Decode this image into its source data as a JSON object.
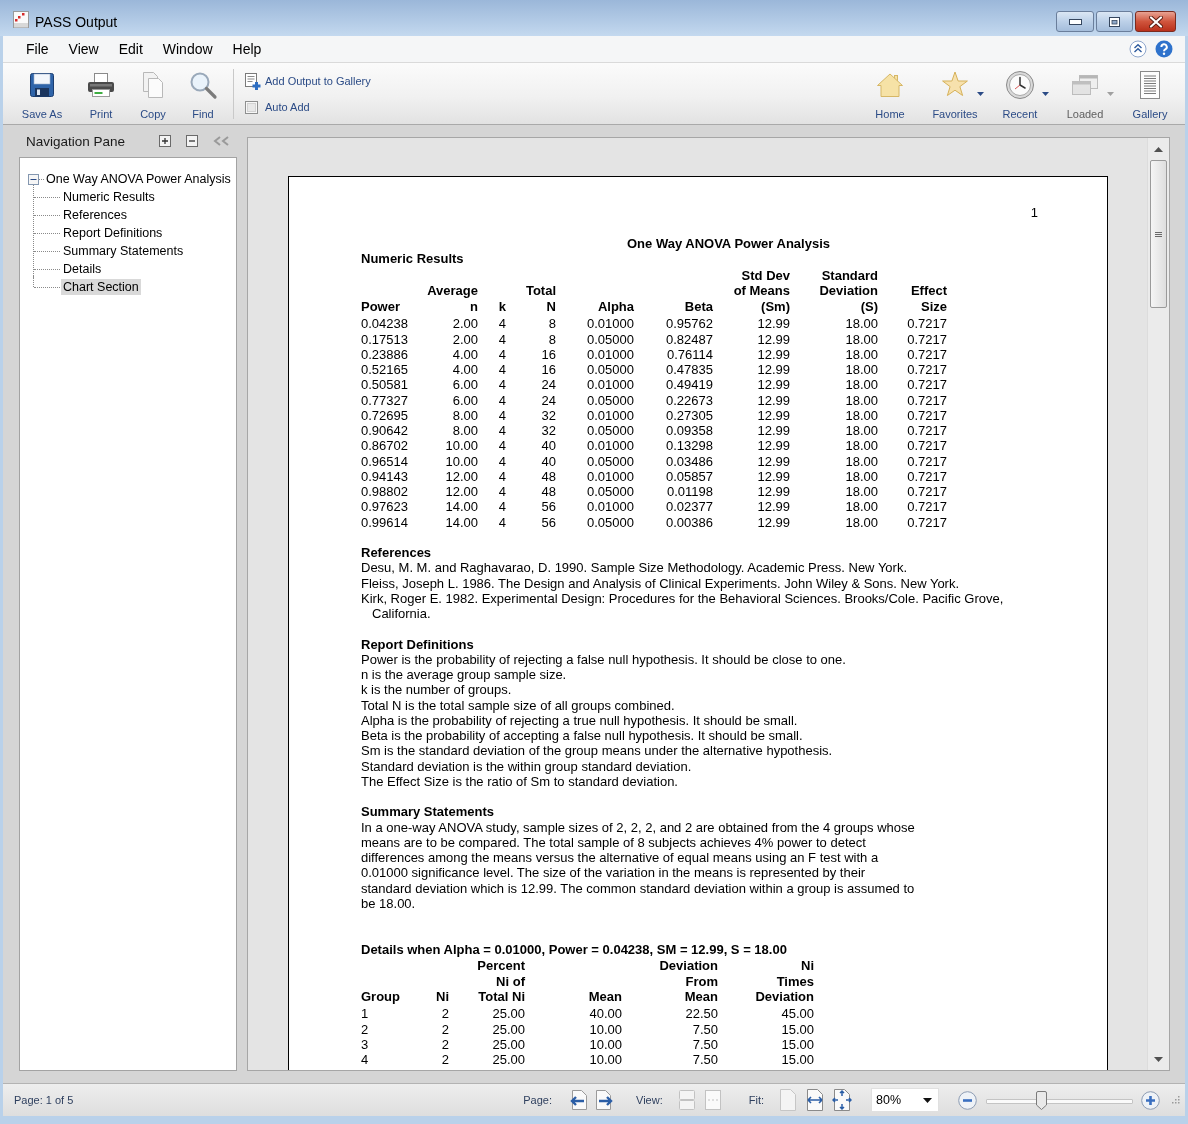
{
  "window": {
    "title": "PASS Output"
  },
  "menu": [
    {
      "label": "File"
    },
    {
      "label": "View"
    },
    {
      "label": "Edit"
    },
    {
      "label": "Window"
    },
    {
      "label": "Help"
    }
  ],
  "toolbar": {
    "buttons": [
      {
        "label": "Save As"
      },
      {
        "label": "Print"
      },
      {
        "label": "Copy"
      },
      {
        "label": "Find"
      }
    ],
    "add_to_gallery": {
      "label": "Add Output to Gallery"
    },
    "auto_add": {
      "label": "Auto Add",
      "checked": false
    },
    "nav_buttons": [
      {
        "label": "Home",
        "dropdown": false,
        "disabled": false
      },
      {
        "label": "Favorites",
        "dropdown": true,
        "disabled": false
      },
      {
        "label": "Recent",
        "dropdown": true,
        "disabled": false
      },
      {
        "label": "Loaded",
        "dropdown": true,
        "disabled": true
      },
      {
        "label": "Gallery",
        "dropdown": false,
        "disabled": false
      }
    ]
  },
  "navigation_pane": {
    "title": "Navigation Pane",
    "tree": [
      {
        "label": "One Way ANOVA Power Analysis",
        "expanded": true,
        "selected": false,
        "children": [
          {
            "label": "Numeric Results",
            "selected": false
          },
          {
            "label": "References",
            "selected": false
          },
          {
            "label": "Report Definitions",
            "selected": false
          },
          {
            "label": "Summary Statements",
            "selected": false
          },
          {
            "label": "Details",
            "selected": false
          },
          {
            "label": "Chart Section",
            "selected": true
          }
        ]
      }
    ]
  },
  "document": {
    "page_number": "1",
    "title": "One Way ANOVA Power Analysis",
    "numeric_results": {
      "heading": "Numeric Results",
      "columns": [
        {
          "lines": [
            "Power"
          ]
        },
        {
          "lines": [
            "Average",
            "n"
          ]
        },
        {
          "lines": [
            "k"
          ]
        },
        {
          "lines": [
            "Total",
            "N"
          ]
        },
        {
          "lines": [
            "Alpha"
          ]
        },
        {
          "lines": [
            "Beta"
          ]
        },
        {
          "lines": [
            "Std Dev",
            "of Means",
            "(Sm)"
          ]
        },
        {
          "lines": [
            "Standard",
            "Deviation",
            "(S)"
          ]
        },
        {
          "lines": [
            "Effect",
            "Size"
          ]
        }
      ],
      "rows": [
        [
          "0.04238",
          "2.00",
          "4",
          "8",
          "0.01000",
          "0.95762",
          "12.99",
          "18.00",
          "0.7217"
        ],
        [
          "0.17513",
          "2.00",
          "4",
          "8",
          "0.05000",
          "0.82487",
          "12.99",
          "18.00",
          "0.7217"
        ],
        [
          "0.23886",
          "4.00",
          "4",
          "16",
          "0.01000",
          "0.76114",
          "12.99",
          "18.00",
          "0.7217"
        ],
        [
          "0.52165",
          "4.00",
          "4",
          "16",
          "0.05000",
          "0.47835",
          "12.99",
          "18.00",
          "0.7217"
        ],
        [
          "0.50581",
          "6.00",
          "4",
          "24",
          "0.01000",
          "0.49419",
          "12.99",
          "18.00",
          "0.7217"
        ],
        [
          "0.77327",
          "6.00",
          "4",
          "24",
          "0.05000",
          "0.22673",
          "12.99",
          "18.00",
          "0.7217"
        ],
        [
          "0.72695",
          "8.00",
          "4",
          "32",
          "0.01000",
          "0.27305",
          "12.99",
          "18.00",
          "0.7217"
        ],
        [
          "0.90642",
          "8.00",
          "4",
          "32",
          "0.05000",
          "0.09358",
          "12.99",
          "18.00",
          "0.7217"
        ],
        [
          "0.86702",
          "10.00",
          "4",
          "40",
          "0.01000",
          "0.13298",
          "12.99",
          "18.00",
          "0.7217"
        ],
        [
          "0.96514",
          "10.00",
          "4",
          "40",
          "0.05000",
          "0.03486",
          "12.99",
          "18.00",
          "0.7217"
        ],
        [
          "0.94143",
          "12.00",
          "4",
          "48",
          "0.01000",
          "0.05857",
          "12.99",
          "18.00",
          "0.7217"
        ],
        [
          "0.98802",
          "12.00",
          "4",
          "48",
          "0.05000",
          "0.01198",
          "12.99",
          "18.00",
          "0.7217"
        ],
        [
          "0.97623",
          "14.00",
          "4",
          "56",
          "0.01000",
          "0.02377",
          "12.99",
          "18.00",
          "0.7217"
        ],
        [
          "0.99614",
          "14.00",
          "4",
          "56",
          "0.05000",
          "0.00386",
          "12.99",
          "18.00",
          "0.7217"
        ]
      ]
    },
    "references": {
      "heading": "References",
      "items": [
        "Desu, M. M. and Raghavarao, D. 1990. Sample Size Methodology. Academic Press. New York.",
        "Fleiss, Joseph L. 1986. The Design and Analysis of Clinical Experiments. John Wiley & Sons. New York.",
        "Kirk, Roger E. 1982. Experimental Design: Procedures for the Behavioral Sciences. Brooks/Cole. Pacific Grove, California."
      ]
    },
    "report_definitions": {
      "heading": "Report Definitions",
      "lines": [
        "Power is the probability of rejecting a false null hypothesis. It should be close to one.",
        "n is the average group sample size.",
        "k is the number of groups.",
        "Total N is the total sample size of all groups combined.",
        "Alpha is the probability of rejecting a true null hypothesis. It should be small.",
        "Beta is the probability of accepting a false null hypothesis. It should be small.",
        "Sm is the standard deviation of the group means under the alternative hypothesis.",
        "Standard deviation is the within group standard deviation.",
        "The Effect Size is the ratio of Sm to standard deviation."
      ]
    },
    "summary_statements": {
      "heading": "Summary Statements",
      "lines": [
        "In a one-way ANOVA study, sample sizes of 2, 2, 2, and 2 are obtained from the 4 groups whose",
        "means are to be compared. The total sample of 8 subjects achieves 4% power to detect",
        "differences among the means versus the alternative of equal means using an F test with a",
        "0.01000 significance level. The size of the variation in the means is represented by their",
        "standard deviation which is 12.99. The common standard deviation within a group is assumed to",
        "be 18.00."
      ]
    },
    "details": {
      "heading": "Details when Alpha = 0.01000, Power = 0.04238, SM = 12.99, S = 18.00",
      "columns": [
        {
          "lines": [
            "Group"
          ]
        },
        {
          "lines": [
            "Ni"
          ]
        },
        {
          "lines": [
            "Percent",
            "Ni of",
            "Total Ni"
          ]
        },
        {
          "lines": [
            "Mean"
          ]
        },
        {
          "lines": [
            "Deviation",
            "From",
            "Mean"
          ]
        },
        {
          "lines": [
            "Ni",
            "Times",
            "Deviation"
          ]
        }
      ],
      "rows": [
        [
          "1",
          "2",
          "25.00",
          "40.00",
          "22.50",
          "45.00"
        ],
        [
          "2",
          "2",
          "25.00",
          "10.00",
          "7.50",
          "15.00"
        ],
        [
          "3",
          "2",
          "25.00",
          "10.00",
          "7.50",
          "15.00"
        ],
        [
          "4",
          "2",
          "25.00",
          "10.00",
          "7.50",
          "15.00"
        ]
      ]
    }
  },
  "status_bar": {
    "page_info": "Page: 1 of 5",
    "page_label": "Page:",
    "view_label": "View:",
    "view_buttons": [
      {
        "disabled": true
      },
      {
        "disabled": true
      }
    ],
    "fit_label": "Fit:",
    "fit_buttons": [
      {
        "disabled": true
      },
      {
        "disabled": false
      },
      {
        "disabled": false
      }
    ],
    "zoom": {
      "value": "80%"
    },
    "zoom_slider": {
      "level": 0.37
    }
  }
}
